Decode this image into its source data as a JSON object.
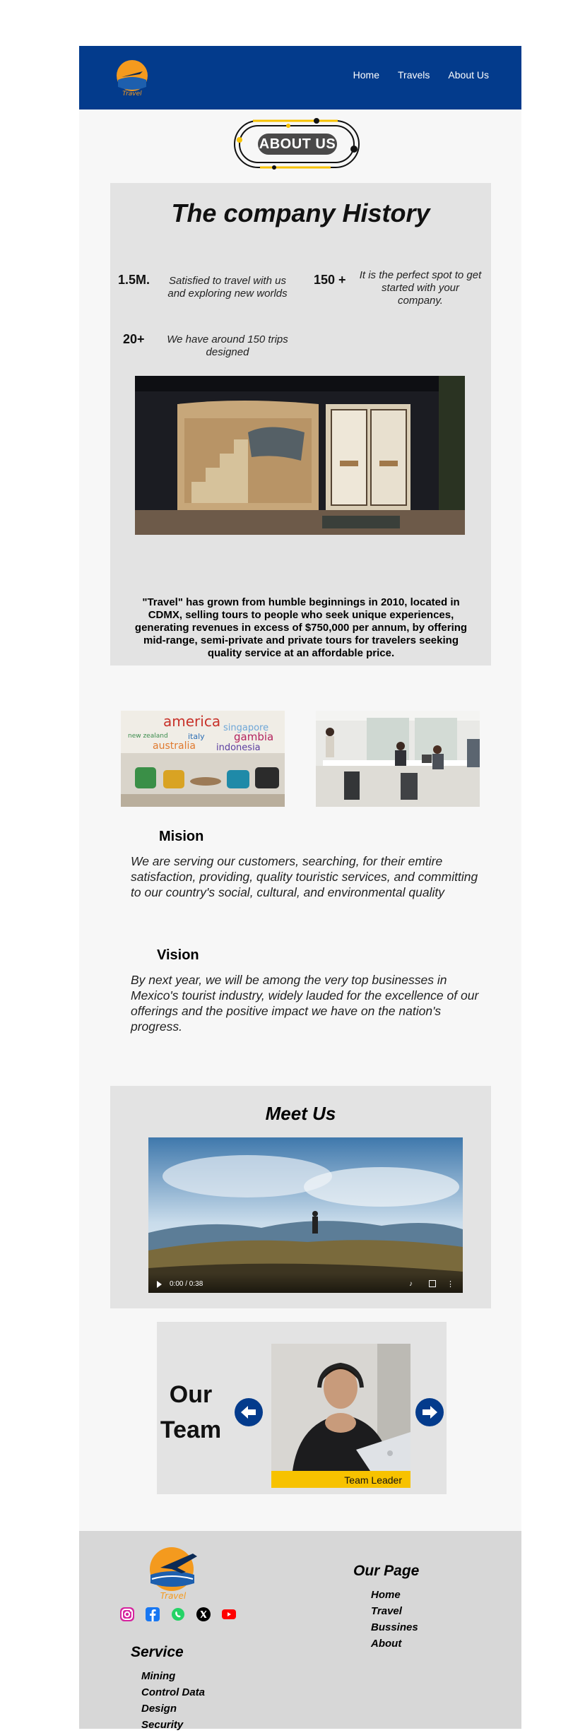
{
  "header": {
    "logo_text": "Travel",
    "nav": [
      "Home",
      "Travels",
      "About Us"
    ]
  },
  "about_badge": "ABOUT US",
  "history": {
    "title": "The company History",
    "stats": [
      {
        "number": "1.5M.",
        "text": "Satisfied to travel with us and exploring new worlds"
      },
      {
        "number": "150 +",
        "text": "It is the perfect spot to get started with your company."
      },
      {
        "number": "20+",
        "text": "We have around 150 trips designed"
      }
    ],
    "description": "\"Travel\" has grown from humble beginnings in 2010, located in CDMX, selling tours to people who seek unique experiences, generating revenues in excess of $750,000 per annum, by offering mid-range, semi-private and private tours for travelers seeking quality service at an affordable price."
  },
  "office_wall_words": [
    "america",
    "singapore",
    "italy",
    "gambia",
    "australia",
    "indonesia",
    "new zealand"
  ],
  "mission": {
    "title": "Mision",
    "text": "We are serving our customers, searching, for their emtire satisfaction, providing, quality touristic services, and committing to our country's social, cultural, and environmental quality"
  },
  "vision": {
    "title": "Vision",
    "text": "By next year, we will be among the very top businesses in Mexico's tourist industry, widely lauded for the excellence of our offerings and the positive impact we have on the nation's progress."
  },
  "meet": {
    "title": "Meet Us",
    "video_time": "0:00 / 0:38"
  },
  "team": {
    "title_line1": "Our",
    "title_line2": "Team",
    "member_role": "Team Leader"
  },
  "footer": {
    "logo_text": "Travel",
    "social_icons": [
      "instagram-icon",
      "facebook-icon",
      "whatsapp-icon",
      "x-icon",
      "youtube-icon"
    ],
    "our_page_title": "Our Page",
    "our_page_links": [
      "Home",
      "Travel",
      "Bussines",
      "About"
    ],
    "service_title": "Service",
    "service_links": [
      "Mining",
      "Control Data",
      "Design",
      "Security"
    ]
  },
  "colors": {
    "brand_blue": "#033b8c",
    "accent_yellow": "#f7c200",
    "panel_gray": "#e3e3e3",
    "footer_gray": "#d7d7d7"
  }
}
